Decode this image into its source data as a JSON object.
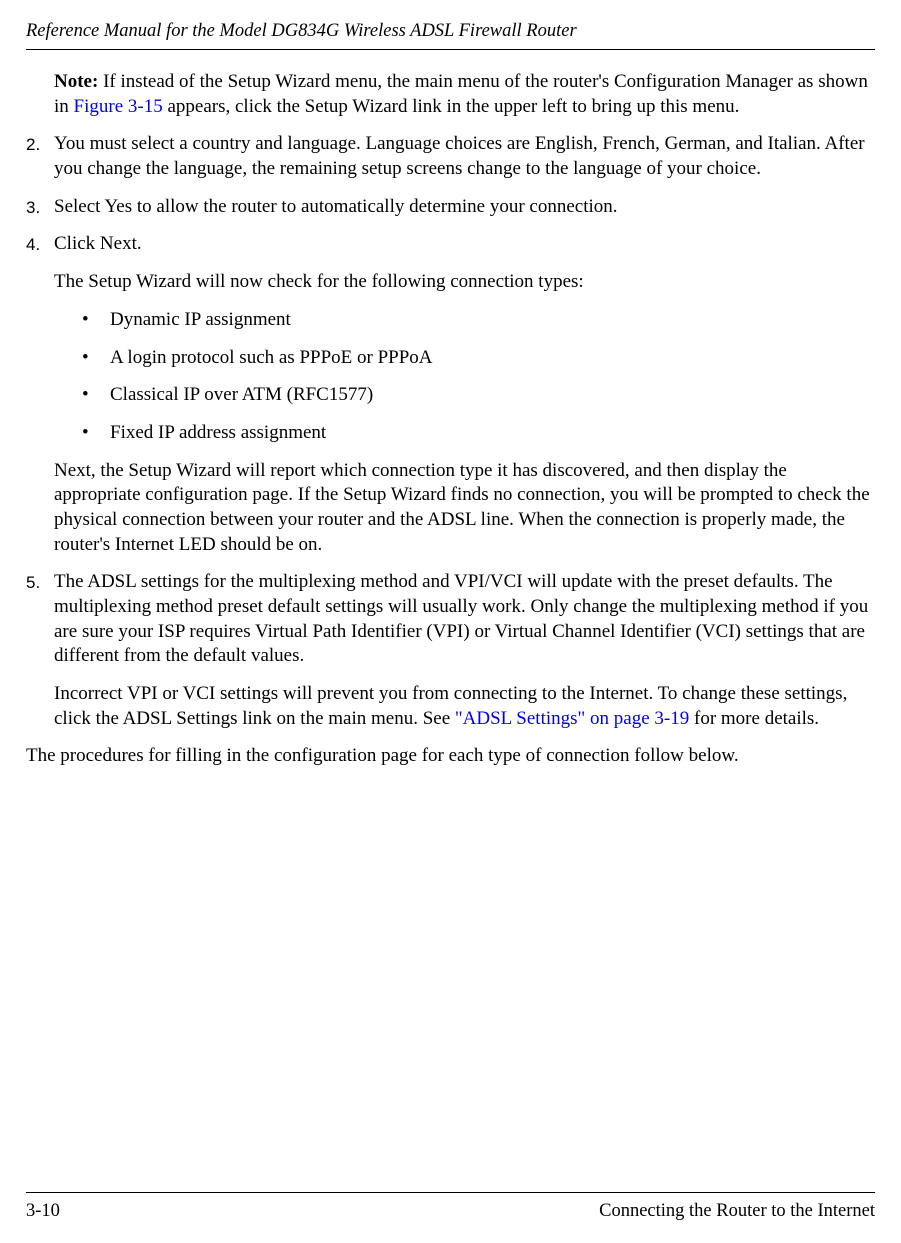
{
  "header": {
    "title": "Reference Manual for the Model DG834G Wireless ADSL Firewall Router"
  },
  "note": {
    "label": "Note:",
    "text_before_link": " If instead of the Setup Wizard menu, the main menu of the router's Configuration Manager as shown in ",
    "link": "Figure 3-15",
    "text_after_link": " appears, click the Setup Wizard link in the upper left to bring up this menu."
  },
  "steps": {
    "s2": {
      "num": "2.",
      "text": "You must select a country and language. Language choices are English, French, German, and Italian. After you change the language, the remaining setup screens change to the language of your choice."
    },
    "s3": {
      "num": "3.",
      "text": "Select Yes to allow the router to automatically determine your connection."
    },
    "s4": {
      "num": "4.",
      "p1": "Click Next.",
      "p2": "The Setup Wizard will now check for the following connection types:",
      "bullets": {
        "b1": "Dynamic IP assignment",
        "b2": "A login protocol such as PPPoE or PPPoA",
        "b3": "Classical IP over ATM (RFC1577)",
        "b4": "Fixed IP address assignment"
      },
      "p3": "Next, the Setup Wizard will report which connection type it has discovered, and then display the appropriate configuration page. If the Setup Wizard finds no connection, you will be prompted to check the physical connection between your router and the ADSL line. When the connection is properly made, the router's Internet LED should be on."
    },
    "s5": {
      "num": "5.",
      "p1": "The ADSL settings for the multiplexing method and VPI/VCI will update with the preset defaults. The multiplexing method preset default settings will usually work. Only change the multiplexing method if you are sure your ISP requires Virtual Path Identifier (VPI) or Virtual Channel Identifier (VCI) settings that are different from the default values.",
      "p2_before": "Incorrect VPI or VCI settings will prevent you from connecting to the Internet. To change these settings, click the ADSL Settings link on the main menu. See ",
      "p2_link": "\"ADSL Settings\" on page 3-19",
      "p2_after": " for more details."
    }
  },
  "closing": "The procedures for filling in the configuration page for each type of connection follow below.",
  "footer": {
    "page": "3-10",
    "section": "Connecting the Router to the Internet"
  },
  "bullet_char": "•"
}
